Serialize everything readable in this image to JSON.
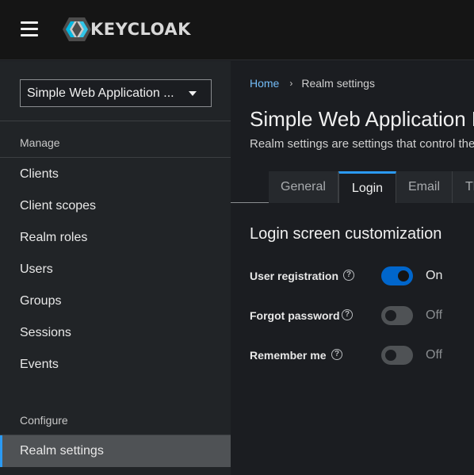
{
  "header": {
    "brand": "KEYCLOAK",
    "menu_icon": "hamburger-menu-icon",
    "logo_icon": "keycloak-logo-icon"
  },
  "sidebar": {
    "realm_selector": {
      "value": "Simple Web Application ...",
      "icon": "caret-down-icon"
    },
    "sections": [
      {
        "label": "Manage"
      },
      {
        "label": "Configure"
      }
    ],
    "items": [
      {
        "label": "Clients"
      },
      {
        "label": "Client scopes"
      },
      {
        "label": "Realm roles"
      },
      {
        "label": "Users"
      },
      {
        "label": "Groups"
      },
      {
        "label": "Sessions"
      },
      {
        "label": "Events"
      },
      {
        "label": "Realm settings",
        "active": true
      }
    ]
  },
  "breadcrumb": {
    "home": "Home",
    "separator": "›",
    "current": "Realm settings"
  },
  "page": {
    "title": "Simple Web Application Realm",
    "description": "Realm settings are settings that control the options"
  },
  "tabs": [
    {
      "label": "General"
    },
    {
      "label": "Login",
      "active": true
    },
    {
      "label": "Email"
    },
    {
      "label": "Themes"
    }
  ],
  "login": {
    "section_title": "Login screen customization",
    "settings": [
      {
        "label": "User registration",
        "state": "On",
        "enabled": true
      },
      {
        "label": "Forgot password",
        "state": "Off",
        "enabled": false
      },
      {
        "label": "Remember me",
        "state": "Off",
        "enabled": false
      }
    ]
  },
  "colors": {
    "accent": "#2b9af3",
    "switch_on": "#0066cc",
    "link": "#73bcf7"
  }
}
